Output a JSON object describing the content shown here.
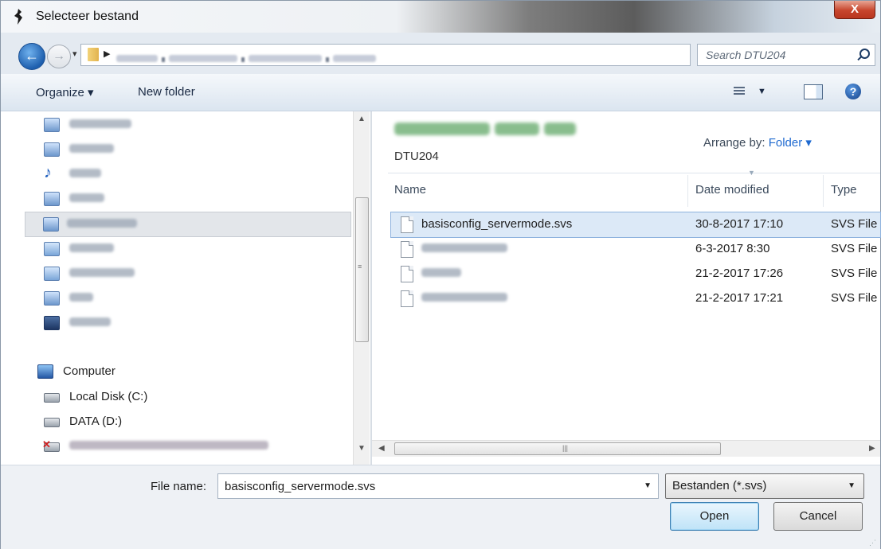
{
  "window": {
    "title": "Selecteer bestand",
    "close_label": "X"
  },
  "navigation": {
    "back_glyph": "←",
    "forward_glyph": "→"
  },
  "search": {
    "placeholder": "Search DTU204"
  },
  "toolbar": {
    "organize_label": "Organize ▾",
    "new_folder_label": "New folder"
  },
  "nav_pane": {
    "computer_label": "Computer",
    "drives": [
      "Local Disk (C:)",
      "DATA (D:)"
    ]
  },
  "content": {
    "library_subtitle": "DTU204",
    "arrange_label": "Arrange by:",
    "arrange_value": "Folder ▾",
    "columns": {
      "name": "Name",
      "date": "Date modified",
      "type": "Type"
    },
    "files": [
      {
        "name": "basisconfig_servermode.svs",
        "date": "30-8-2017 17:10",
        "type": "SVS File"
      },
      {
        "name": "",
        "date": "6-3-2017 8:30",
        "type": "SVS File"
      },
      {
        "name": "",
        "date": "21-2-2017 17:26",
        "type": "SVS File"
      },
      {
        "name": "",
        "date": "21-2-2017 17:21",
        "type": "SVS File"
      }
    ]
  },
  "bottom": {
    "file_name_label": "File name:",
    "file_name_value": "basisconfig_servermode.svs",
    "filter_value": "Bestanden (*.svs)",
    "open_label": "Open",
    "cancel_label": "Cancel"
  },
  "colors": {
    "selection": "#dce9f7",
    "selection_border": "#8fb3de",
    "link": "#1f6ad0"
  }
}
